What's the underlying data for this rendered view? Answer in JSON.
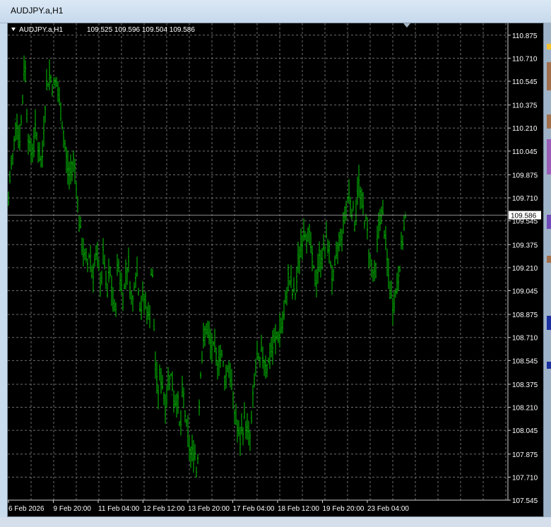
{
  "window": {
    "title": "AUDJPY.a,H1"
  },
  "chart_data": {
    "type": "bar",
    "symbol_header": "AUDJPY.a,H1",
    "ohlc_header": "109.525 109.596 109.504 109.586",
    "current_price": "109.586",
    "colors": {
      "background": "#000000",
      "bars": "#00c800",
      "grid": "#6e6e6e",
      "text": "#ffffff",
      "price_line": "#8c8c8c"
    },
    "grid": true,
    "ylim": [
      107.545,
      110.96
    ],
    "y_ticks": [
      "110.875",
      "110.710",
      "110.545",
      "110.375",
      "110.210",
      "110.045",
      "109.875",
      "109.710",
      "109.545",
      "109.375",
      "109.210",
      "109.045",
      "108.875",
      "108.710",
      "108.545",
      "108.375",
      "108.210",
      "108.045",
      "107.875",
      "107.710",
      "107.545"
    ],
    "x_ticks": [
      "6 Feb 2026",
      "9 Feb 20:00",
      "11 Feb 04:00",
      "12 Feb 12:00",
      "13 Feb 20:00",
      "17 Feb 04:00",
      "18 Feb 12:00",
      "19 Feb 20:00",
      "23 Feb 04:00"
    ],
    "series_points": [
      [
        0,
        109.6
      ],
      [
        4,
        109.92
      ],
      [
        8,
        110.02
      ],
      [
        12,
        110.36
      ],
      [
        16,
        110.1
      ],
      [
        20,
        110.3
      ],
      [
        24,
        110.76
      ],
      [
        28,
        110.22
      ],
      [
        32,
        110.0
      ],
      [
        36,
        110.12
      ],
      [
        40,
        110.2
      ],
      [
        44,
        110.05
      ],
      [
        48,
        109.9
      ],
      [
        52,
        110.35
      ],
      [
        56,
        110.55
      ],
      [
        60,
        110.6
      ],
      [
        64,
        110.5
      ],
      [
        68,
        110.55
      ],
      [
        72,
        110.42
      ],
      [
        76,
        110.3
      ],
      [
        80,
        110.1
      ],
      [
        84,
        109.95
      ],
      [
        88,
        109.85
      ],
      [
        92,
        110.0
      ],
      [
        96,
        109.9
      ],
      [
        100,
        109.6
      ],
      [
        104,
        109.4
      ],
      [
        108,
        109.3
      ],
      [
        112,
        109.2
      ],
      [
        116,
        109.35
      ],
      [
        120,
        109.15
      ],
      [
        124,
        109.3
      ],
      [
        128,
        109.2
      ],
      [
        132,
        109.1
      ],
      [
        136,
        109.35
      ],
      [
        140,
        108.95
      ],
      [
        144,
        109.2
      ],
      [
        148,
        109.0
      ],
      [
        152,
        108.85
      ],
      [
        156,
        109.3
      ],
      [
        160,
        109.1
      ],
      [
        164,
        109.0
      ],
      [
        168,
        109.25
      ],
      [
        172,
        109.2
      ],
      [
        176,
        108.9
      ],
      [
        180,
        109.2
      ],
      [
        184,
        109.15
      ],
      [
        188,
        108.9
      ],
      [
        192,
        109.0
      ],
      [
        196,
        108.95
      ],
      [
        200,
        108.8
      ],
      [
        204,
        109.3
      ],
      [
        208,
        108.6
      ],
      [
        212,
        108.3
      ],
      [
        216,
        108.45
      ],
      [
        220,
        108.35
      ],
      [
        224,
        108.2
      ],
      [
        228,
        108.5
      ],
      [
        232,
        108.4
      ],
      [
        236,
        108.25
      ],
      [
        240,
        108.3
      ],
      [
        244,
        108.0
      ],
      [
        248,
        108.35
      ],
      [
        252,
        108.1
      ],
      [
        256,
        107.95
      ],
      [
        260,
        107.85
      ],
      [
        264,
        107.95
      ],
      [
        268,
        107.7
      ],
      [
        272,
        108.45
      ],
      [
        276,
        108.6
      ],
      [
        280,
        108.8
      ],
      [
        284,
        108.7
      ],
      [
        288,
        108.65
      ],
      [
        292,
        108.6
      ],
      [
        296,
        108.55
      ],
      [
        300,
        108.6
      ],
      [
        304,
        108.55
      ],
      [
        308,
        108.4
      ],
      [
        312,
        108.55
      ],
      [
        316,
        108.4
      ],
      [
        320,
        108.2
      ],
      [
        324,
        108.1
      ],
      [
        328,
        107.95
      ],
      [
        332,
        108.05
      ],
      [
        336,
        108.15
      ],
      [
        340,
        108.0
      ],
      [
        344,
        108.0
      ],
      [
        348,
        108.35
      ],
      [
        352,
        108.55
      ],
      [
        356,
        108.5
      ],
      [
        360,
        108.6
      ],
      [
        364,
        108.55
      ],
      [
        368,
        108.5
      ],
      [
        372,
        108.6
      ],
      [
        376,
        108.65
      ],
      [
        380,
        108.7
      ],
      [
        384,
        108.75
      ],
      [
        388,
        108.8
      ],
      [
        392,
        108.85
      ],
      [
        396,
        109.15
      ],
      [
        400,
        109.1
      ],
      [
        404,
        109.0
      ],
      [
        408,
        109.05
      ],
      [
        412,
        109.3
      ],
      [
        416,
        109.4
      ],
      [
        420,
        109.5
      ],
      [
        424,
        109.45
      ],
      [
        428,
        109.4
      ],
      [
        432,
        109.2
      ],
      [
        436,
        109.1
      ],
      [
        440,
        109.25
      ],
      [
        444,
        109.3
      ],
      [
        448,
        109.35
      ],
      [
        452,
        109.4
      ],
      [
        456,
        109.3
      ],
      [
        460,
        109.1
      ],
      [
        464,
        109.2
      ],
      [
        468,
        109.4
      ],
      [
        472,
        109.45
      ],
      [
        476,
        109.55
      ],
      [
        480,
        109.7
      ],
      [
        484,
        109.75
      ],
      [
        488,
        109.6
      ],
      [
        492,
        109.55
      ],
      [
        496,
        109.85
      ],
      [
        500,
        109.7
      ],
      [
        504,
        109.6
      ],
      [
        508,
        109.5
      ],
      [
        512,
        109.3
      ],
      [
        516,
        109.2
      ],
      [
        520,
        109.1
      ],
      [
        524,
        109.5
      ],
      [
        528,
        109.6
      ],
      [
        532,
        109.55
      ],
      [
        536,
        109.3
      ],
      [
        540,
        109.1
      ],
      [
        544,
        108.95
      ],
      [
        548,
        109.0
      ],
      [
        552,
        109.1
      ],
      [
        556,
        109.3
      ],
      [
        560,
        109.45
      ],
      [
        564,
        109.586
      ]
    ]
  }
}
